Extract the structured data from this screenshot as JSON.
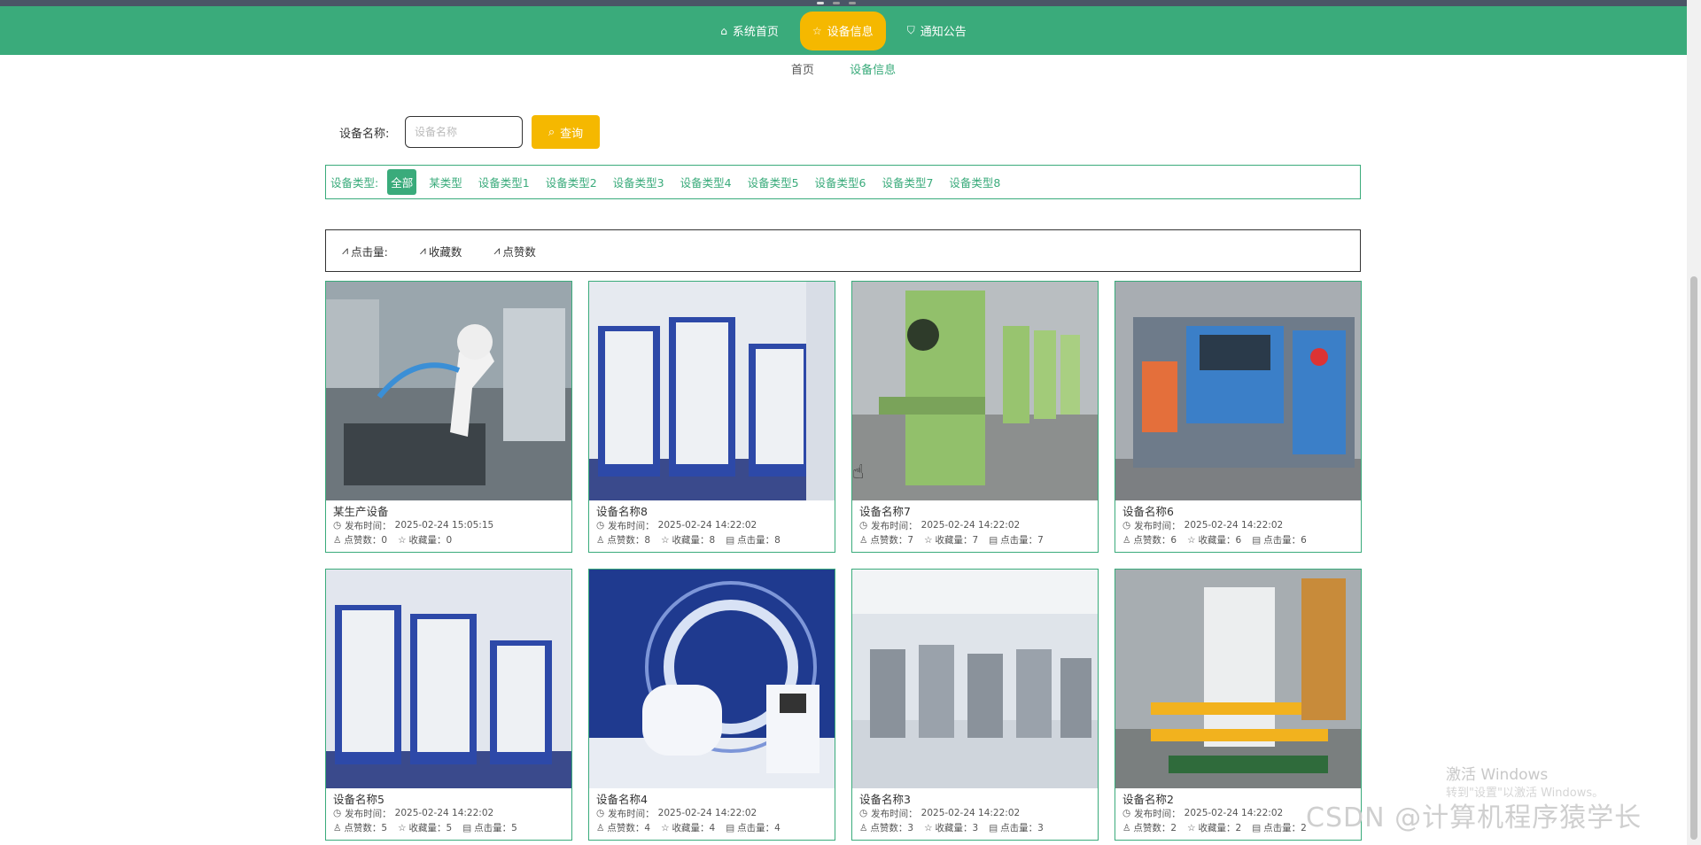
{
  "nav": {
    "items": [
      {
        "icon": "home-icon",
        "label": "系统首页"
      },
      {
        "icon": "star-icon",
        "label": "设备信息"
      },
      {
        "icon": "bag-icon",
        "label": "通知公告"
      }
    ],
    "active_index": 1
  },
  "breadcrumb": {
    "home": "首页",
    "current": "设备信息"
  },
  "search": {
    "label": "设备名称:",
    "placeholder": "设备名称",
    "button": "查询"
  },
  "filter": {
    "label": "设备类型:",
    "items": [
      "全部",
      "某类型",
      "设备类型1",
      "设备类型2",
      "设备类型3",
      "设备类型4",
      "设备类型5",
      "设备类型6",
      "设备类型7",
      "设备类型8"
    ],
    "active_index": 0
  },
  "sort": {
    "items": [
      "点击量:",
      "收藏数",
      "点赞数"
    ]
  },
  "cards": [
    {
      "name": "某生产设备",
      "time": "2025-02-24 15:05:15",
      "likes": "0",
      "favs": "0",
      "clicks": ""
    },
    {
      "name": "设备名称8",
      "time": "2025-02-24 14:22:02",
      "likes": "8",
      "favs": "8",
      "clicks": "8"
    },
    {
      "name": "设备名称7",
      "time": "2025-02-24 14:22:02",
      "likes": "7",
      "favs": "7",
      "clicks": "7"
    },
    {
      "name": "设备名称6",
      "time": "2025-02-24 14:22:02",
      "likes": "6",
      "favs": "6",
      "clicks": "6"
    },
    {
      "name": "设备名称5",
      "time": "2025-02-24 14:22:02",
      "likes": "5",
      "favs": "5",
      "clicks": "5"
    },
    {
      "name": "设备名称4",
      "time": "2025-02-24 14:22:02",
      "likes": "4",
      "favs": "4",
      "clicks": "4"
    },
    {
      "name": "设备名称3",
      "time": "2025-02-24 14:22:02",
      "likes": "3",
      "favs": "3",
      "clicks": "3"
    },
    {
      "name": "设备名称2",
      "time": "2025-02-24 14:22:02",
      "likes": "2",
      "favs": "2",
      "clicks": "2"
    }
  ],
  "labels": {
    "time": "发布时间：",
    "likes": "点赞数：",
    "favs": "收藏量：",
    "clicks": "点击量："
  },
  "watermark": {
    "line1": "激活 Windows",
    "line2": "转到\"设置\"以激活 Windows。",
    "csdn": "CSDN @计算机程序猿学长"
  },
  "colors": {
    "primary": "#3aab7b",
    "accent": "#f5b800"
  }
}
